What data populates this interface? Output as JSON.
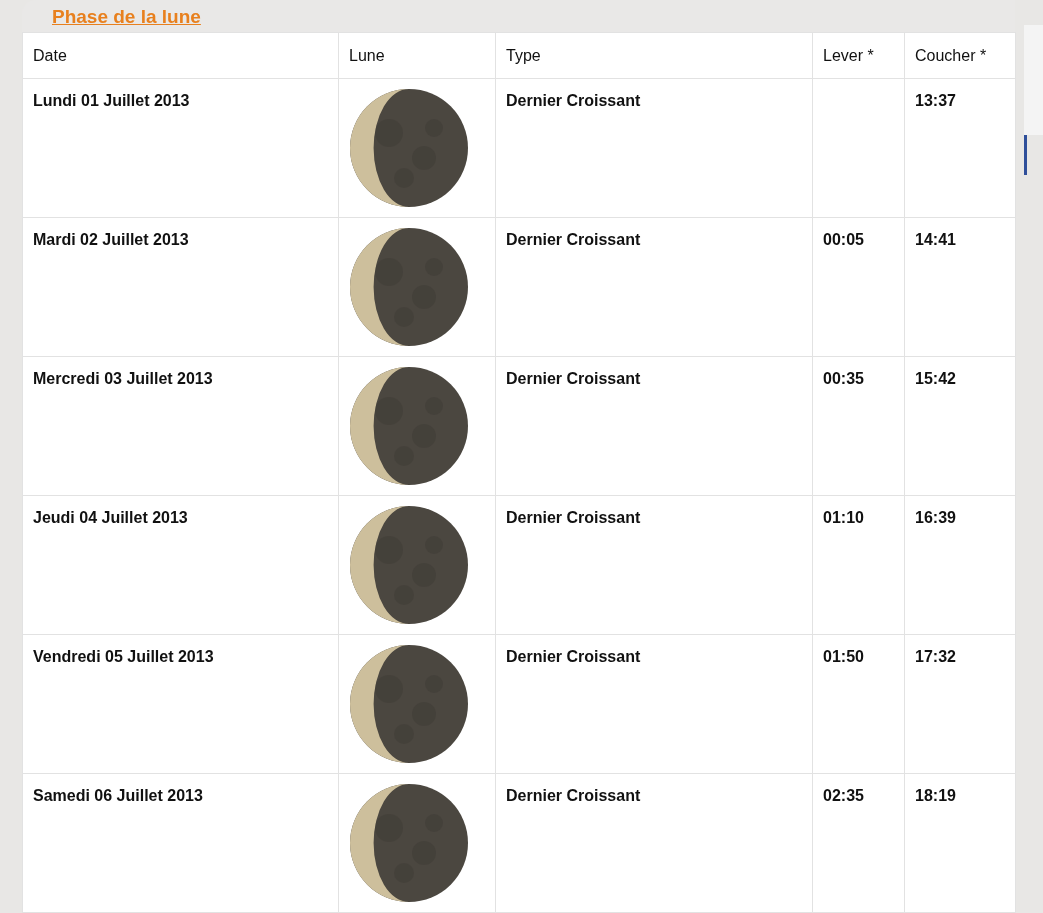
{
  "title": "Phase de la lune",
  "columns": [
    "Date",
    "Lune",
    "Type",
    "Lever *",
    "Coucher *"
  ],
  "rows": [
    {
      "date": "Lundi 01 Juillet 2013",
      "type": "Dernier Croissant",
      "rise": "",
      "set": "13:37"
    },
    {
      "date": "Mardi 02 Juillet 2013",
      "type": "Dernier Croissant",
      "rise": "00:05",
      "set": "14:41"
    },
    {
      "date": "Mercredi 03 Juillet 2013",
      "type": "Dernier Croissant",
      "rise": "00:35",
      "set": "15:42"
    },
    {
      "date": "Jeudi 04 Juillet 2013",
      "type": "Dernier Croissant",
      "rise": "01:10",
      "set": "16:39"
    },
    {
      "date": "Vendredi 05 Juillet 2013",
      "type": "Dernier Croissant",
      "rise": "01:50",
      "set": "17:32"
    },
    {
      "date": "Samedi 06 Juillet 2013",
      "type": "Dernier Croissant",
      "rise": "02:35",
      "set": "18:19"
    }
  ]
}
